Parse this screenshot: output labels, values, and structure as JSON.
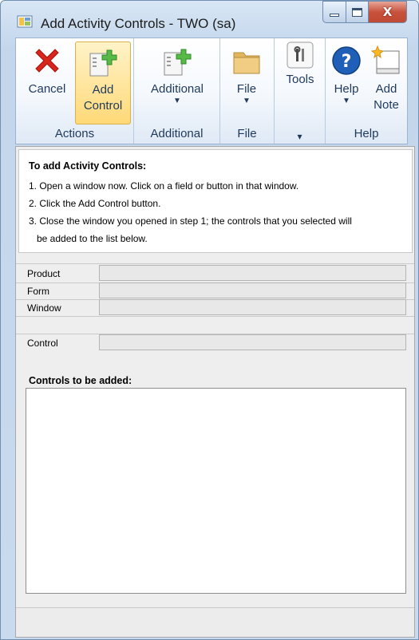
{
  "window": {
    "title": "Add Activity Controls  -  TWO (sa)"
  },
  "ribbon": {
    "groups": [
      {
        "label": "Actions"
      },
      {
        "label": "Additional"
      },
      {
        "label": "File"
      },
      {
        "label": ""
      },
      {
        "label": "Help"
      }
    ],
    "buttons": {
      "cancel": {
        "label": "Cancel",
        "icon": "cancel-x-icon",
        "color": "#d9261c"
      },
      "add_control": {
        "label_line1": "Add",
        "label_line2": "Control",
        "icon": "add-control-icon",
        "color": "#57b947"
      },
      "additional": {
        "label": "Additional",
        "icon": "additional-icon"
      },
      "file": {
        "label": "File",
        "icon": "folder-icon",
        "color": "#e0b760"
      },
      "tools": {
        "label": "Tools",
        "icon": "tools-icon"
      },
      "help": {
        "label": "Help",
        "icon": "help-icon",
        "color": "#1f5fb8"
      },
      "add_note": {
        "label_line1": "Add",
        "label_line2": "Note",
        "icon": "note-icon"
      }
    },
    "tools_group_arrow": "▾"
  },
  "instructions": {
    "title": "To add Activity Controls:",
    "lines": [
      "1. Open a window now. Click on a field or button in that window.",
      "2. Click the Add Control button.",
      "3. Close the window you opened in step 1; the controls that you selected will",
      "be added to the list below."
    ]
  },
  "fields": {
    "product": {
      "label": "Product",
      "value": ""
    },
    "form": {
      "label": "Form",
      "value": ""
    },
    "window": {
      "label": "Window",
      "value": ""
    },
    "control": {
      "label": "Control",
      "value": ""
    }
  },
  "controls_list": {
    "title": "Controls to be added:",
    "items": []
  }
}
